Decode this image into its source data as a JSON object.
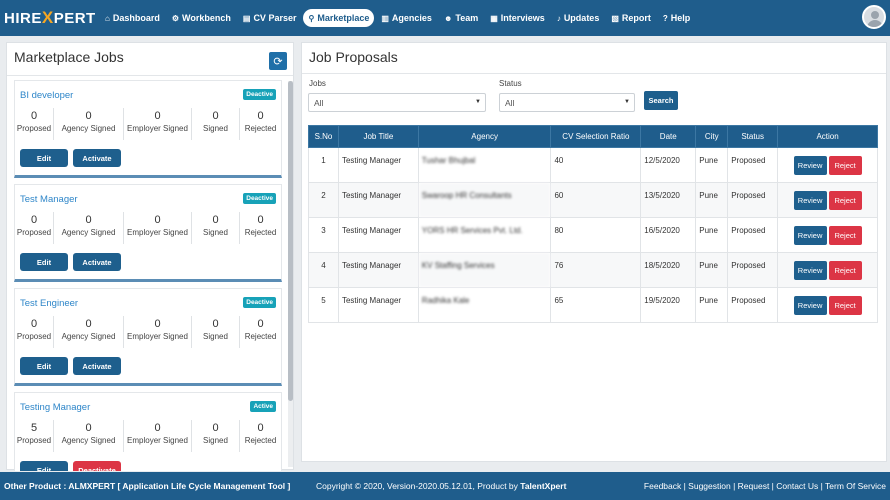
{
  "app": {
    "logo_left": "HIRE",
    "logo_x": "X",
    "logo_right": "PERT"
  },
  "nav": {
    "items": [
      {
        "label": "Dashboard",
        "icon": "home-icon",
        "glyph": "⌂"
      },
      {
        "label": "Workbench",
        "icon": "cogs-icon",
        "glyph": "⚙"
      },
      {
        "label": "CV Parser",
        "icon": "file-icon",
        "glyph": "▤"
      },
      {
        "label": "Marketplace",
        "icon": "map-marker-icon",
        "glyph": "⚲"
      },
      {
        "label": "Agencies",
        "icon": "building-icon",
        "glyph": "▥"
      },
      {
        "label": "Team",
        "icon": "users-icon",
        "glyph": "☻"
      },
      {
        "label": "Interviews",
        "icon": "calendar-icon",
        "glyph": "▦"
      },
      {
        "label": "Updates",
        "icon": "bell-icon",
        "glyph": "♪"
      },
      {
        "label": "Report",
        "icon": "report-icon",
        "glyph": "▧"
      },
      {
        "label": "Help",
        "icon": "question-icon",
        "glyph": "?"
      }
    ],
    "active": "Marketplace"
  },
  "left": {
    "title": "Marketplace Jobs",
    "refresh_icon": "refresh-icon",
    "stat_labels": [
      "Proposed",
      "Agency Signed",
      "Employer Signed",
      "Signed",
      "Rejected"
    ],
    "edit_label": "Edit",
    "activate_label": "Activate",
    "deactivate_label": "Deactivate",
    "jobs": [
      {
        "name": "BI developer",
        "status": "Deactive",
        "stats": [
          "0",
          "0",
          "0",
          "0",
          "0"
        ],
        "action": "Activate"
      },
      {
        "name": "Test Manager",
        "status": "Deactive",
        "stats": [
          "0",
          "0",
          "0",
          "0",
          "0"
        ],
        "action": "Activate"
      },
      {
        "name": "Test Engineer",
        "status": "Deactive",
        "stats": [
          "0",
          "0",
          "0",
          "0",
          "0"
        ],
        "action": "Activate"
      },
      {
        "name": "Testing Manager",
        "status": "Active",
        "stats": [
          "5",
          "0",
          "0",
          "0",
          "0"
        ],
        "action": "Deactivate"
      }
    ]
  },
  "right": {
    "title": "Job Proposals",
    "jobs_label": "Jobs",
    "jobs_value": "All",
    "status_label": "Status",
    "status_value": "All",
    "search_label": "Search",
    "columns": [
      "S.No",
      "Job Title",
      "Agency",
      "CV Selection Ratio",
      "Date",
      "City",
      "Status",
      "Action"
    ],
    "review_label": "Review",
    "reject_label": "Reject",
    "rows": [
      {
        "no": "1",
        "title": "Testing Manager",
        "agency": "Tushar Bhujbal",
        "ratio": "40",
        "date": "12/5/2020",
        "city": "Pune",
        "status": "Proposed"
      },
      {
        "no": "2",
        "title": "Testing Manager",
        "agency": "Swaroop HR Consultants",
        "ratio": "60",
        "date": "13/5/2020",
        "city": "Pune",
        "status": "Proposed"
      },
      {
        "no": "3",
        "title": "Testing Manager",
        "agency": "YORS HR Services Pvt. Ltd.",
        "ratio": "80",
        "date": "16/5/2020",
        "city": "Pune",
        "status": "Proposed"
      },
      {
        "no": "4",
        "title": "Testing Manager",
        "agency": "KV Staffing Services",
        "ratio": "76",
        "date": "18/5/2020",
        "city": "Pune",
        "status": "Proposed"
      },
      {
        "no": "5",
        "title": "Testing Manager",
        "agency": "Radhika Kale",
        "ratio": "65",
        "date": "19/5/2020",
        "city": "Pune",
        "status": "Proposed"
      }
    ]
  },
  "footer": {
    "other_product": "Other Product : ALMXPERT [ Application Life Cycle Management Tool ]",
    "copyright": "Copyright © 2020, Version-2020.05.12.01, Product by ",
    "brand": "TalentXpert",
    "links": "Feedback | Suggestion | Request | Contact Us | Term Of Service"
  },
  "colors": {
    "primary": "#1f5d8c",
    "danger": "#dc3545",
    "badge": "#17a2b8",
    "link": "#2e86c9"
  }
}
